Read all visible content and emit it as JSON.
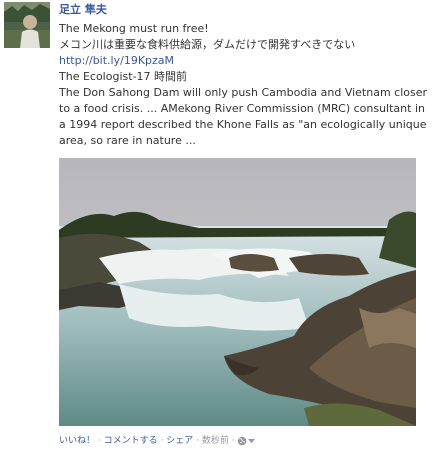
{
  "post": {
    "author": "足立 隼夫",
    "message_line1": "The Mekong must run free!",
    "message_line2": "メコン川は重要な食料供給源，ダムだけで開発すべきでない",
    "link": "http://bit.ly/19KpzaM",
    "attachment": {
      "source": "The Ecologist",
      "time": "17 時間前",
      "description": "The Don Sahong Dam will only push Cambodia and Vietnam closer to a food crisis. ... AMekong River Commission (MRC) consultant in a 1994 report described the Khone Falls as \"an ecologically unique area, so rare in nature ..."
    }
  },
  "actions": {
    "like": "いいね！",
    "comment": "コメントする",
    "share": "シェア",
    "timestamp": "数秒前",
    "separator": " · ",
    "audience_icon": "globe-icon",
    "menu_icon": "chevron-down-icon"
  },
  "colors": {
    "link": "#3b5998",
    "text": "#333333",
    "meta": "#9197a3"
  }
}
